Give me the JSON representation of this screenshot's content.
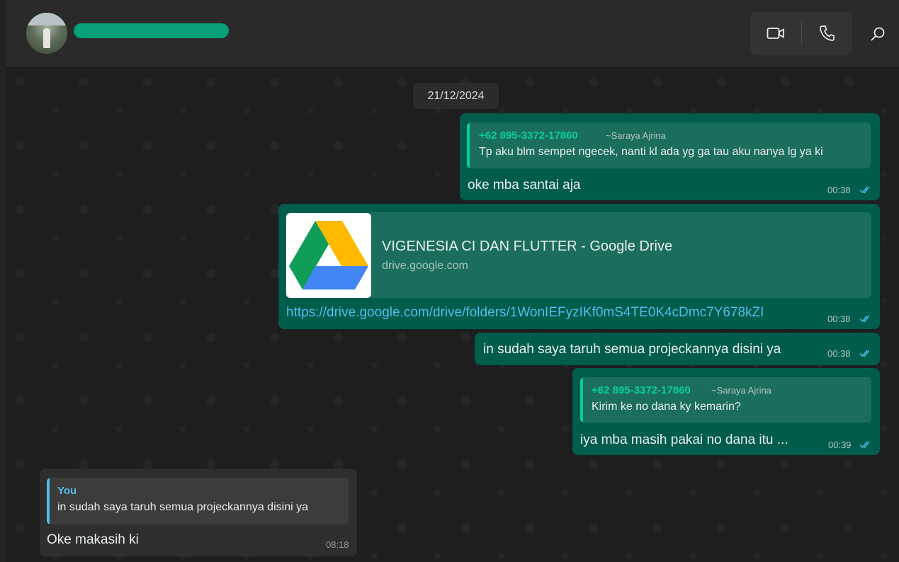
{
  "header": {
    "contact_name_redacted": true,
    "video_call_label": "Video call",
    "voice_call_label": "Voice call",
    "search_label": "Search"
  },
  "chat": {
    "date_chip": "21/12/2024",
    "messages": [
      {
        "direction": "out",
        "quote": {
          "phone": "+62 895-3372-17860",
          "alias": "~Saraya Ajrina",
          "text": "Tp aku blm sempet ngecek, nanti kl ada yg ga tau aku nanya lg ya ki"
        },
        "text": "oke mba santai aja",
        "time": "00:38",
        "status": "read"
      },
      {
        "direction": "out",
        "link_preview": {
          "title": "VIGENESIA CI DAN FLUTTER - Google Drive",
          "domain": "drive.google.com",
          "icon": "google-drive-icon"
        },
        "text": "https://drive.google.com/drive/folders/1WonIEFyzIKf0mS4TE0K4cDmc7Y678kZI",
        "time": "00:38",
        "status": "read"
      },
      {
        "direction": "out",
        "text": "in sudah saya taruh semua projeckannya disini ya",
        "time": "00:38",
        "status": "read"
      },
      {
        "direction": "out",
        "quote": {
          "phone": "+62 895-3372-17860",
          "alias": "~Saraya Ajrina",
          "text": "Kirim ke no dana ky kemarin?"
        },
        "text": "iya mba masih pakai no dana itu ...",
        "time": "00:39",
        "status": "read"
      },
      {
        "direction": "in",
        "quote": {
          "author": "You",
          "text": "in sudah saya taruh semua projeckannya disini ya"
        },
        "text": "Oke makasih ki",
        "time": "08:18"
      }
    ]
  },
  "colors": {
    "outgoing_bubble": "#005c4b",
    "incoming_bubble": "#2e2e2e",
    "accent_green": "#06cf9c",
    "link_blue": "#53bdeb",
    "background": "#1e1e1e"
  }
}
